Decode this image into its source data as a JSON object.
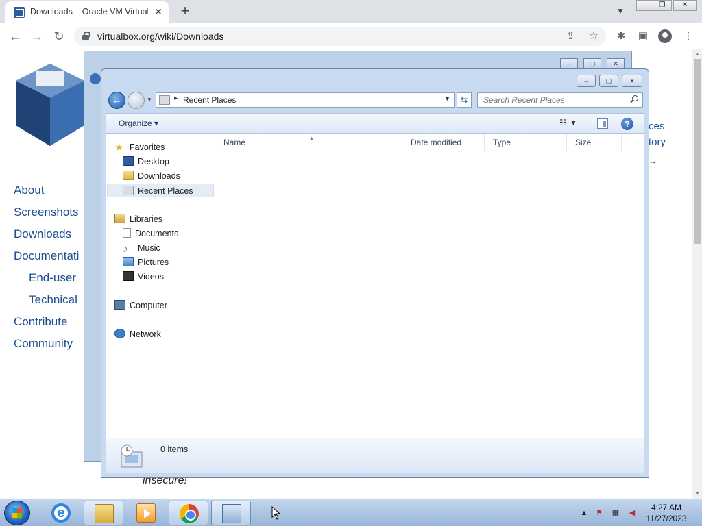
{
  "browser": {
    "tab_title": "Downloads – Oracle VM VirtualB",
    "tab_close": "✕",
    "new_tab": "+",
    "url": "virtualbox.org/wiki/Downloads"
  },
  "webpage": {
    "nav": [
      {
        "label": "About"
      },
      {
        "label": "Screenshots"
      },
      {
        "label": "Downloads"
      },
      {
        "label": "Documentati"
      },
      {
        "label": "End-user"
      },
      {
        "label": "Technical"
      },
      {
        "label": "Contribute"
      },
      {
        "label": "Community"
      }
    ],
    "right_links": [
      "ces",
      "tory",
      "→"
    ],
    "insecure_text": "insecure!"
  },
  "explorer": {
    "address": "Recent Places",
    "search_placeholder": "Search Recent Places",
    "organize_label": "Organize",
    "nav_pane": {
      "favorites": "Favorites",
      "desktop": "Desktop",
      "downloads": "Downloads",
      "recent_places": "Recent Places",
      "libraries": "Libraries",
      "documents": "Documents",
      "music": "Music",
      "pictures": "Pictures",
      "videos": "Videos",
      "computer": "Computer",
      "network": "Network"
    },
    "columns": [
      "Name",
      "Date modified",
      "Type",
      "Size"
    ],
    "item_count": "0 items"
  },
  "taskbar": {
    "time": "4:27 AM",
    "date": "11/27/2023"
  }
}
